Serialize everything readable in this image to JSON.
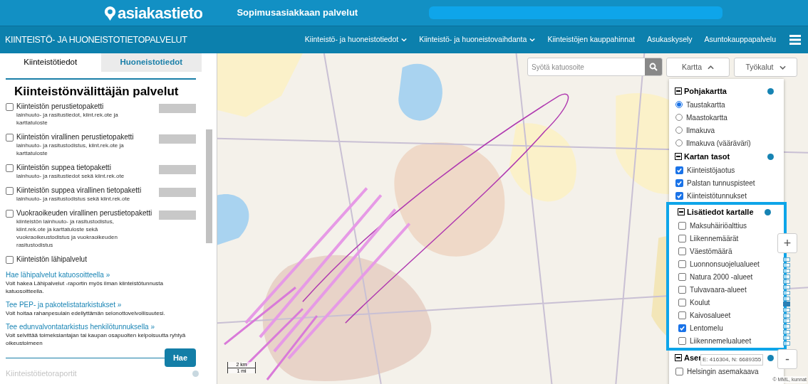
{
  "header": {
    "logo": "asiakastieto",
    "title": "Sopimusasiakkaan palvelut"
  },
  "nav": {
    "title": "KIINTEISTÖ- JA HUONEISTOTIETOPALVELUT",
    "items": [
      {
        "label": "Kiinteistö- ja huoneistotiedot",
        "dropdown": true
      },
      {
        "label": "Kiinteistö- ja huoneistovaihdanta",
        "dropdown": true
      },
      {
        "label": "Kiinteistöjen kauppahinnat",
        "dropdown": false
      },
      {
        "label": "Asukaskysely",
        "dropdown": false
      },
      {
        "label": "Asuntokauppapalvelu",
        "dropdown": false
      }
    ]
  },
  "tabs": [
    {
      "label": "Kiinteistötiedot",
      "selected": true
    },
    {
      "label": "Huoneistotiedot",
      "selected": false
    }
  ],
  "panel": {
    "heading": "Kiinteistönvälittäjän palvelut",
    "products": [
      {
        "title": "Kiinteistön perustietopaketti",
        "description": "lainhuuto- ja rasitustiedot, kiint.rek.ote ja karttatuloste",
        "checked": false
      },
      {
        "title": "Kiinteistön virallinen perustietopaketti",
        "description": "lainhuuto- ja rasitustodistus, kiint.rek.ote ja karttatuloste",
        "checked": false
      },
      {
        "title": "Kiinteistön suppea tietopaketti",
        "description": "lainhuuto- ja rasitustiedot sekä kiint.rek.ote",
        "checked": false
      },
      {
        "title": "Kiinteistön suppea virallinen tietopaketti",
        "description": "lainhuuto- ja rasitustodistus sekä kiint.rek.ote",
        "checked": false
      },
      {
        "title": "Vuokraoikeuden virallinen perustietopaketti",
        "description": "kiinteistön lainhuuto- ja rasitustodistus, kiint.rek.ote ja karttatuloste sekä vuokraoikeustodistus ja vuokraoikeuden rasitustodistus",
        "checked": false
      },
      {
        "title": "Kiinteistön lähipalvelut",
        "checked": false
      }
    ],
    "links": [
      {
        "link": "Hae lähipalvelut katuosoitteella »",
        "text": "Voit hakea Lähipalvelut -raportin myös ilman kiinteistötunnusta katuosoitteella."
      },
      {
        "link": "Tee PEP- ja pakotelistatarkistukset »",
        "text": "Voit hoitaa rahanpesulain edellyttämän selonottovelvollisuutesi."
      },
      {
        "link": "Tee edunvalvontatarkistus henkilötunnuksella »",
        "text": "Voit selvittää toimeksiantajan tai kaupan osapuolten kelpoisuutta ryhtyä oikeustoimeen"
      }
    ],
    "button": "Hae",
    "next_section": "Kiinteistötietoraportit"
  },
  "map": {
    "search": {
      "placeholder": "Syötä katuosoite"
    },
    "buttons": [
      {
        "label": "Kartta",
        "expanded": true
      },
      {
        "label": "Työkalut",
        "expanded": false
      }
    ],
    "layers": [
      {
        "title": "Pohjakartta",
        "expanded": true,
        "highlighted": false,
        "items": [
          {
            "kind": "radio",
            "label": "Taustakartta",
            "selected": true
          },
          {
            "kind": "radio",
            "label": "Maastokartta",
            "selected": false
          },
          {
            "kind": "radio",
            "label": "Ilmakuva",
            "selected": false
          },
          {
            "kind": "radio",
            "label": "Ilmakuva (vääräväri)",
            "selected": false
          }
        ]
      },
      {
        "title": "Kartan tasot",
        "expanded": true,
        "highlighted": false,
        "items": [
          {
            "kind": "checkbox",
            "label": "Kiinteistöjaotus",
            "checked": true
          },
          {
            "kind": "checkbox",
            "label": "Palstan tunnuspisteet",
            "checked": true
          },
          {
            "kind": "checkbox",
            "label": "Kiinteistötunnukset",
            "checked": true
          }
        ]
      },
      {
        "title": "Lisätiedot kartalle",
        "expanded": true,
        "highlighted": true,
        "items": [
          {
            "kind": "checkbox",
            "label": "Maksuhäiriöalttius",
            "checked": false
          },
          {
            "kind": "checkbox",
            "label": "Liikennemäärät",
            "checked": false
          },
          {
            "kind": "checkbox",
            "label": "Väestömäärä",
            "checked": false
          },
          {
            "kind": "checkbox",
            "label": "Luonnonsuojelualueet",
            "checked": false
          },
          {
            "kind": "checkbox",
            "label": "Natura 2000 -alueet",
            "checked": false
          },
          {
            "kind": "checkbox",
            "label": "Tulvavaara-alueet",
            "checked": false
          },
          {
            "kind": "checkbox",
            "label": "Koulut",
            "checked": false
          },
          {
            "kind": "checkbox",
            "label": "Kaivosalueet",
            "checked": false
          },
          {
            "kind": "checkbox",
            "label": "Lentomelu",
            "checked": true
          },
          {
            "kind": "checkbox",
            "label": "Liikennemelualueet",
            "checked": false
          }
        ]
      },
      {
        "title": "Aser",
        "expanded": true,
        "highlighted": false,
        "items": [
          {
            "kind": "checkbox",
            "label": "Helsingin asemakaava",
            "checked": false
          }
        ]
      }
    ],
    "zoom": {
      "in": "+",
      "out": "-",
      "level": 0.47
    },
    "coordinates": "E: 416304, N: 6689355",
    "scale": {
      "metric": "2 km",
      "imperial": "1 mi"
    },
    "attribution": "© MML, kunnat"
  }
}
